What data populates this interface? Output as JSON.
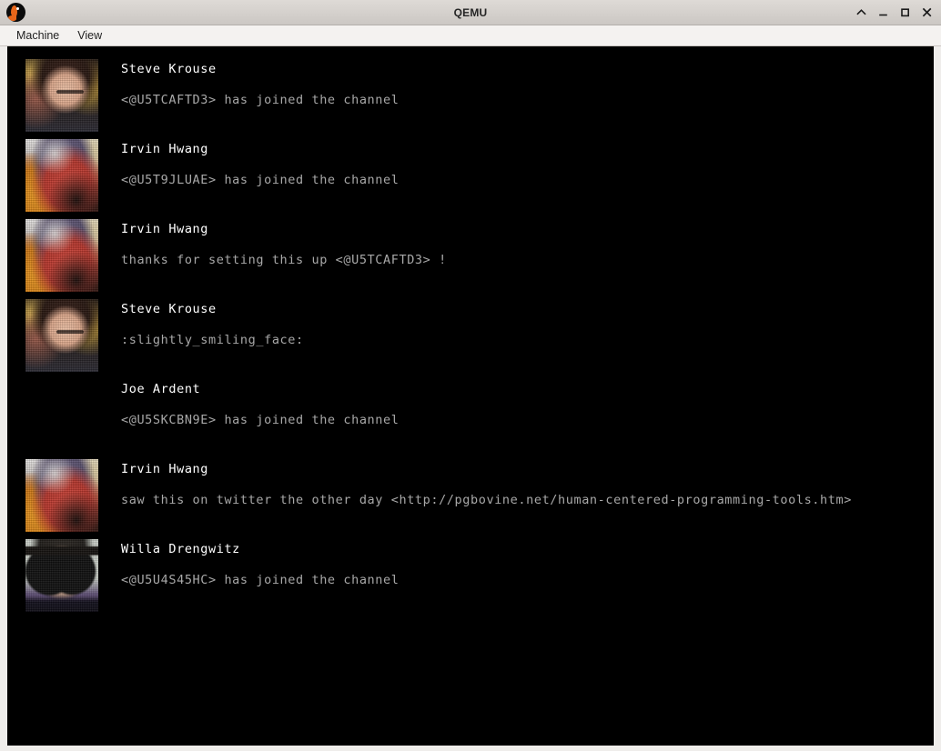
{
  "window": {
    "title": "QEMU",
    "app_icon": "qemu-logo-icon",
    "controls": [
      {
        "name": "shade-button",
        "glyph": "chevron-up-icon"
      },
      {
        "name": "minimize-button",
        "glyph": "minimize-icon"
      },
      {
        "name": "maximize-button",
        "glyph": "maximize-icon"
      },
      {
        "name": "close-button",
        "glyph": "close-icon"
      }
    ]
  },
  "menubar": {
    "items": [
      {
        "label": "Machine"
      },
      {
        "label": "View"
      }
    ]
  },
  "colors": {
    "terminal_background": "#000000",
    "author_text": "#ffffff",
    "message_text": "#a8a8a8",
    "titlebar_background": "#d4d0cc",
    "menubar_background": "#f4f2f0",
    "frame_background": "#efedeb"
  },
  "chat": {
    "messages": [
      {
        "author": "Steve Krouse",
        "text": "<@U5TCAFTD3> has joined the channel",
        "avatar": "steve-krouse-avatar",
        "has_avatar": true
      },
      {
        "author": "Irvin Hwang",
        "text": "<@U5T9JLUAE> has joined the channel",
        "avatar": "irvin-hwang-avatar",
        "has_avatar": true
      },
      {
        "author": "Irvin Hwang",
        "text": "thanks for setting this up <@U5TCAFTD3> !",
        "avatar": "irvin-hwang-avatar",
        "has_avatar": true
      },
      {
        "author": "Steve Krouse",
        "text": ":slightly_smiling_face:",
        "avatar": "steve-krouse-avatar",
        "has_avatar": true
      },
      {
        "author": "Joe Ardent",
        "text": "<@U5SKCBN9E> has joined the channel",
        "avatar": "",
        "has_avatar": false
      },
      {
        "author": "Irvin Hwang",
        "text": "saw this on twitter the other day <http://pgbovine.net/human-centered-programming-tools.htm>",
        "avatar": "irvin-hwang-avatar",
        "has_avatar": true
      },
      {
        "author": "Willa Drengwitz",
        "text": "<@U5U4S45HC> has joined the channel",
        "avatar": "willa-drengwitz-avatar",
        "has_avatar": true
      }
    ]
  }
}
